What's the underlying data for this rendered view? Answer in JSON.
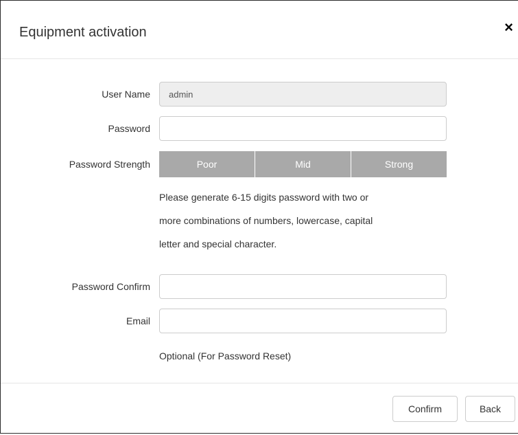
{
  "dialog": {
    "title": "Equipment activation",
    "close_symbol": "×"
  },
  "form": {
    "username": {
      "label": "User Name",
      "value": "admin"
    },
    "password": {
      "label": "Password",
      "value": ""
    },
    "strength": {
      "label": "Password Strength",
      "levels": [
        "Poor",
        "Mid",
        "Strong"
      ]
    },
    "password_hint_lines": [
      "Please generate 6-15 digits password with two or",
      "more combinations of numbers, lowercase, capital",
      "letter and special character."
    ],
    "confirm": {
      "label": "Password Confirm",
      "value": ""
    },
    "email": {
      "label": "Email",
      "value": "",
      "note": "Optional (For Password Reset)"
    }
  },
  "buttons": {
    "confirm": "Confirm",
    "back": "Back"
  },
  "colors": {
    "strength_bar": "#a9a9a9",
    "readonly_bg": "#eeeeee",
    "border": "#cccccc"
  },
  "icons": {
    "close": "close-icon"
  }
}
